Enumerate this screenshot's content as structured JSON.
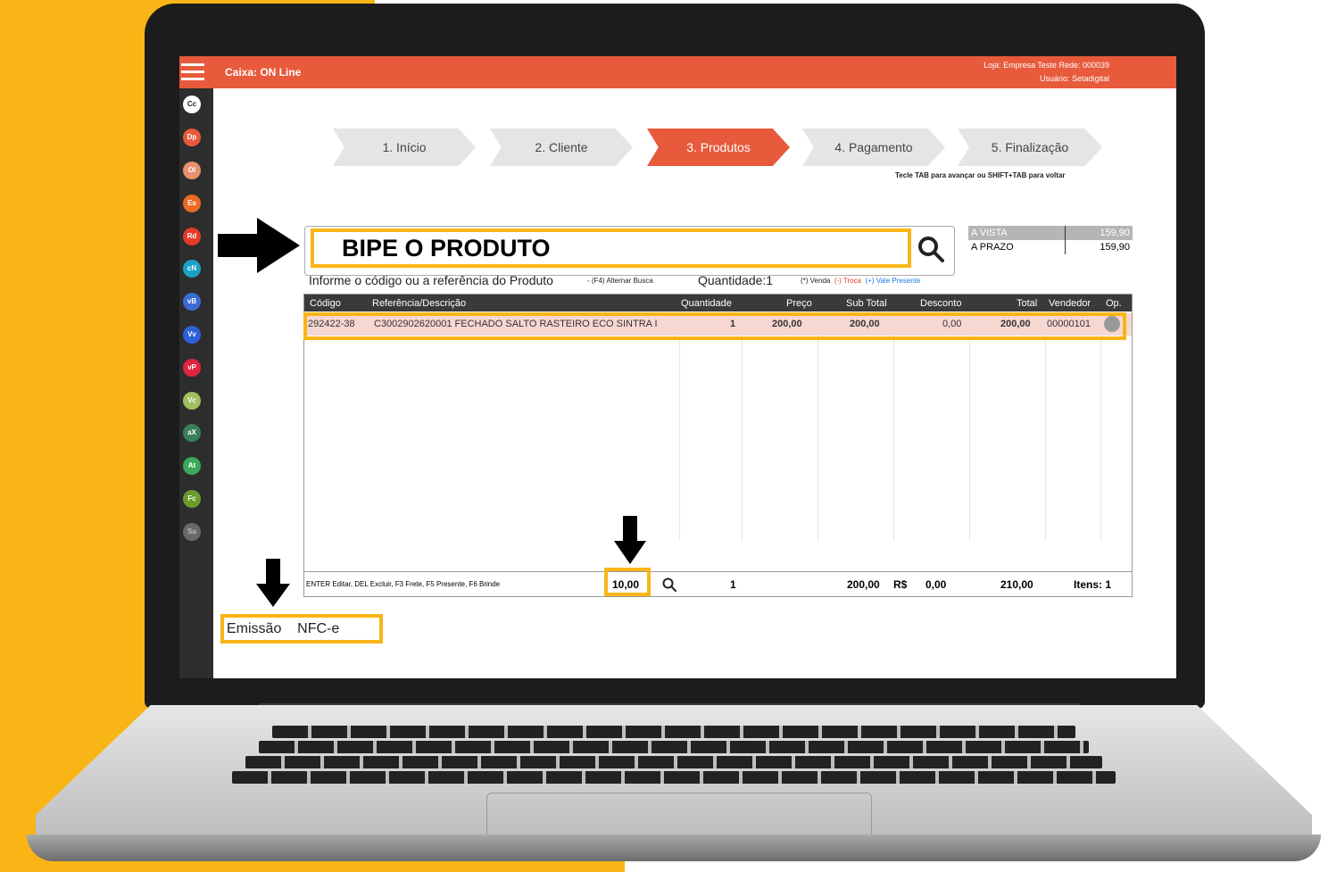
{
  "app": {
    "title": "Caixa: ON Line",
    "loja_label": "Loja: Empresa Teste    Rede: 000039",
    "usuario_label": "Usuário: Setadigital"
  },
  "sidebar": {
    "items": [
      {
        "code": "Cc",
        "color": "#ffffff",
        "text": "#222222"
      },
      {
        "code": "Dp",
        "color": "#e75a3b",
        "text": "#ffffff"
      },
      {
        "code": "Ol",
        "color": "#e7906f",
        "text": "#ffffff"
      },
      {
        "code": "Es",
        "color": "#ea6a22",
        "text": "#ffffff"
      },
      {
        "code": "Rd",
        "color": "#e33a2a",
        "text": "#ffffff"
      },
      {
        "code": "cN",
        "color": "#1aa1c7",
        "text": "#ffffff"
      },
      {
        "code": "vB",
        "color": "#3b6bd3",
        "text": "#ffffff"
      },
      {
        "code": "Vv",
        "color": "#2d5fd8",
        "text": "#ffffff"
      },
      {
        "code": "vP",
        "color": "#e0243d",
        "text": "#ffffff"
      },
      {
        "code": "Vc",
        "color": "#9fbf5f",
        "text": "#ffffff"
      },
      {
        "code": "aX",
        "color": "#3a7d5a",
        "text": "#ffffff"
      },
      {
        "code": "At",
        "color": "#3aa85a",
        "text": "#ffffff"
      },
      {
        "code": "Fc",
        "color": "#6d9a2d",
        "text": "#ffffff"
      },
      {
        "code": "Sa",
        "color": "#6a6a6a",
        "text": "#bbbbbb"
      }
    ]
  },
  "wizard": {
    "steps": [
      "1. Início",
      "2. Cliente",
      "3. Produtos",
      "4. Pagamento",
      "5. Finalização"
    ],
    "active_index": 2,
    "hint": "Tecle TAB para avançar ou SHIFT+TAB para voltar"
  },
  "search": {
    "placeholder": "BIPE O PRODUTO",
    "instruction": "Informe o código ou a referência do Produto",
    "alt_busca": "- (F4) Alternar Busca",
    "quantidade": "Quantidade:1",
    "legend_venda": "(*) Venda",
    "legend_troca": "(-) Troca",
    "legend_vale": "(+) Vale Presente"
  },
  "totals": {
    "a_vista_label": "A VISTA",
    "a_vista_value": "159,90",
    "a_prazo_label": "A PRAZO",
    "a_prazo_value": "159,90"
  },
  "table": {
    "headers": {
      "codigo": "Código",
      "referencia": "Referência/Descrição",
      "quantidade": "Quantidade",
      "preco": "Preço",
      "subtotal": "Sub Total",
      "desconto": "Desconto",
      "total": "Total",
      "vendedor": "Vendedor",
      "op": "Op."
    },
    "rows": [
      {
        "codigo": "292422-38",
        "descricao": "C3002902620001 FECHADO SALTO RASTEIRO ECO SINTRA I",
        "quantidade": "1",
        "preco": "200,00",
        "subtotal": "200,00",
        "desconto": "0,00",
        "total": "200,00",
        "vendedor": "00000101"
      }
    ],
    "footer": {
      "shortcuts": "ENTER Editar, DEL Excluir, F3 Frete, F5 Presente, F6 Brinde",
      "frete": "10,00",
      "qtd": "1",
      "subtotal": "200,00",
      "currency": "R$",
      "desconto": "0,00",
      "total": "210,00",
      "itens": "Itens: 1"
    }
  },
  "emissao": {
    "label": "Emissão",
    "value": "NFC-e"
  },
  "colors": {
    "accent": "#e75a3b",
    "highlight": "#f9b516",
    "background_yellow": "#f9b516"
  }
}
